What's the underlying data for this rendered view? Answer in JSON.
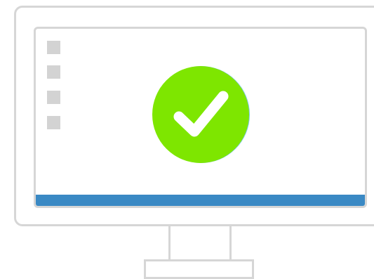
{
  "illustration": {
    "subject": "monitor-success-check",
    "icons": {
      "check": "checkmark-icon",
      "desktop": "desktop-file-icon"
    },
    "desktop_icon_count": 4,
    "colors": {
      "frame": "#d6d6d6",
      "screen_bg": "#ffffff",
      "desktop_icon": "#d3d3d3",
      "taskbar": "#3a89c4",
      "check_circle": "#7ee600",
      "check_mark": "#ffffff"
    }
  }
}
